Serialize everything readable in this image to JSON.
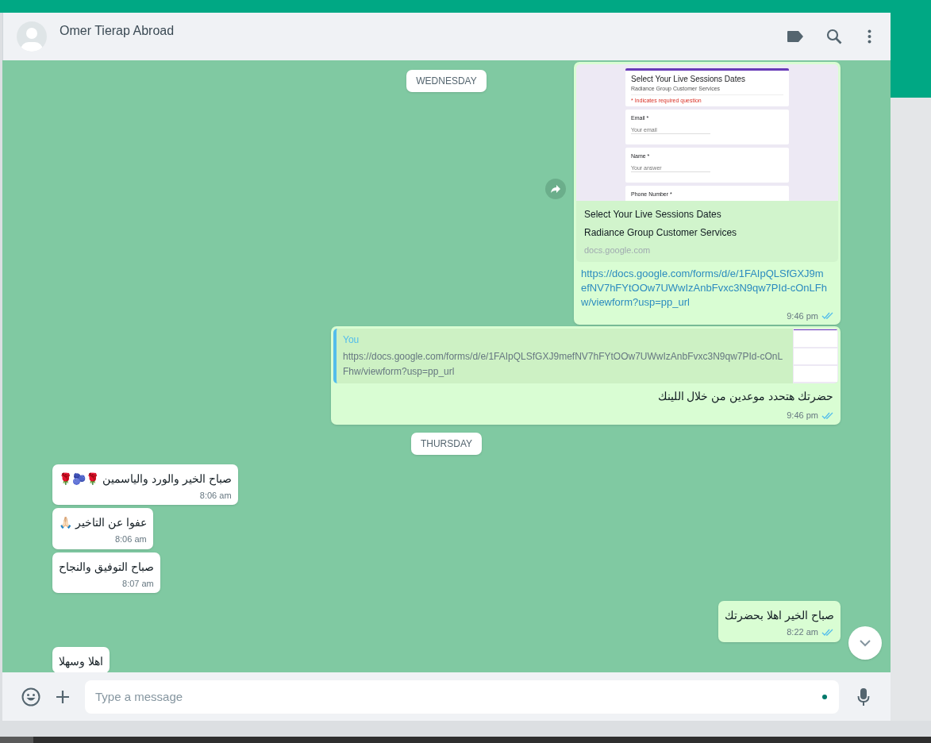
{
  "header": {
    "contact_name": "Omer Tierap Abroad"
  },
  "messages": [
    {
      "kind": "date",
      "text": "WEDNESDAY"
    },
    {
      "kind": "link_preview",
      "preview": {
        "form_title": "Select Your Live Sessions Dates",
        "form_subtitle": "Radiance Group Customer Services",
        "form_note": "* Indicates required question",
        "form_fields": [
          {
            "label": "Email *",
            "placeholder": "Your email"
          },
          {
            "label": "Name *",
            "placeholder": "Your answer"
          },
          {
            "label": "Phone Number *"
          }
        ],
        "title": "Select Your Live Sessions Dates",
        "description": "Radiance Group Customer Services",
        "domain": "docs.google.com"
      },
      "link": "https://docs.google.com/forms/d/e/1FAIpQLSfGXJ9mefNV7hFYtOOw7UWwIzAnbFvxc3N9qw7PId-cOnLFhw/viewform?usp=pp_url",
      "time": "9:46 pm"
    },
    {
      "kind": "quote_reply",
      "quote": {
        "author": "You",
        "text": "https://docs.google.com/forms/d/e/1FAIpQLSfGXJ9mefNV7hFYtOOw7UWwIzAnbFvxc3N9qw7PId-cOnLFhw/viewform?usp=pp_url"
      },
      "text": "حضرتك هتحدد موعدين من خلال اللينك",
      "time": "9:46 pm"
    },
    {
      "kind": "date",
      "text": "THURSDAY"
    },
    {
      "kind": "incoming",
      "text": "صباح الخير والورد والياسمين 🌹🫐🌹",
      "time": "8:06 am"
    },
    {
      "kind": "incoming",
      "text": "عفوا عن التاخير 🙏🏻",
      "time": "8:06 am"
    },
    {
      "kind": "incoming",
      "text": "صباح التوفيق والنجاح",
      "time": "8:07 am"
    },
    {
      "kind": "outgoing",
      "text": "صباح الخير اهلا بحضرتك",
      "time": "8:22 am"
    },
    {
      "kind": "incoming",
      "text": "اهلا وسهلا"
    }
  ],
  "composer": {
    "placeholder": "Type a message"
  }
}
